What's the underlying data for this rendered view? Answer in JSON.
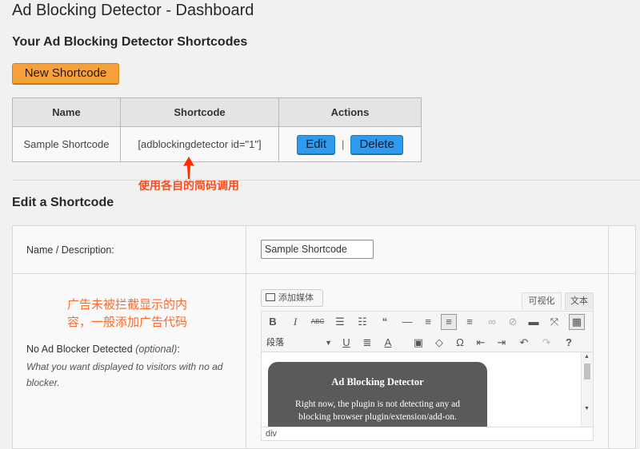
{
  "page": {
    "title": "Ad Blocking Detector - Dashboard",
    "section_title": "Your Ad Blocking Detector Shortcodes",
    "new_button": "New Shortcode"
  },
  "table": {
    "headers": [
      "Name",
      "Shortcode",
      "Actions"
    ],
    "rows": [
      {
        "name": "Sample Shortcode",
        "shortcode": "[adblockingdetector id=\"1\"]",
        "edit": "Edit",
        "separator": "|",
        "delete": "Delete"
      }
    ]
  },
  "annotations": {
    "shortcode_hint": "使用各自的简码调用",
    "content_hint_line1": "广告未被拦截显示的内",
    "content_hint_line2": "容，一般添加广告代码"
  },
  "edit_section": {
    "title": "Edit a Shortcode",
    "name_label": "Name / Description:",
    "name_value": "Sample Shortcode",
    "nab_label": "No Ad Blocker Detected",
    "nab_optional": "(optional)",
    "nab_colon": ":",
    "nab_help": "What you want displayed to visitors with no ad blocker."
  },
  "editor": {
    "add_media": "添加媒体",
    "tab_visual": "可视化",
    "tab_text": "文本",
    "format_select": "段落",
    "preview_title": "Ad Blocking Detector",
    "preview_text": "Right now, the plugin is not detecting any ad blocking browser plugin/extension/add-on.",
    "status_path": "div"
  },
  "colors": {
    "new_button": "#f7a13b",
    "action_button": "#2e9bf0",
    "annotation": "#ff4a1a"
  }
}
